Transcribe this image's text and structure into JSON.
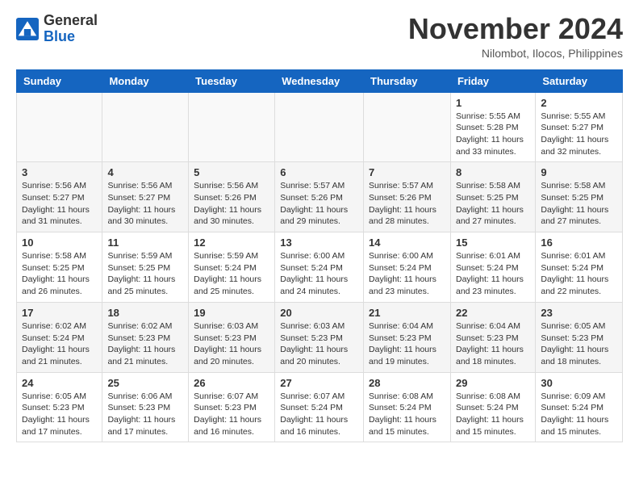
{
  "header": {
    "logo_general": "General",
    "logo_blue": "Blue",
    "month_title": "November 2024",
    "location": "Nilombot, Ilocos, Philippines"
  },
  "weekdays": [
    "Sunday",
    "Monday",
    "Tuesday",
    "Wednesday",
    "Thursday",
    "Friday",
    "Saturday"
  ],
  "weeks": [
    [
      {
        "day": "",
        "detail": ""
      },
      {
        "day": "",
        "detail": ""
      },
      {
        "day": "",
        "detail": ""
      },
      {
        "day": "",
        "detail": ""
      },
      {
        "day": "",
        "detail": ""
      },
      {
        "day": "1",
        "detail": "Sunrise: 5:55 AM\nSunset: 5:28 PM\nDaylight: 11 hours\nand 33 minutes."
      },
      {
        "day": "2",
        "detail": "Sunrise: 5:55 AM\nSunset: 5:27 PM\nDaylight: 11 hours\nand 32 minutes."
      }
    ],
    [
      {
        "day": "3",
        "detail": "Sunrise: 5:56 AM\nSunset: 5:27 PM\nDaylight: 11 hours\nand 31 minutes."
      },
      {
        "day": "4",
        "detail": "Sunrise: 5:56 AM\nSunset: 5:27 PM\nDaylight: 11 hours\nand 30 minutes."
      },
      {
        "day": "5",
        "detail": "Sunrise: 5:56 AM\nSunset: 5:26 PM\nDaylight: 11 hours\nand 30 minutes."
      },
      {
        "day": "6",
        "detail": "Sunrise: 5:57 AM\nSunset: 5:26 PM\nDaylight: 11 hours\nand 29 minutes."
      },
      {
        "day": "7",
        "detail": "Sunrise: 5:57 AM\nSunset: 5:26 PM\nDaylight: 11 hours\nand 28 minutes."
      },
      {
        "day": "8",
        "detail": "Sunrise: 5:58 AM\nSunset: 5:25 PM\nDaylight: 11 hours\nand 27 minutes."
      },
      {
        "day": "9",
        "detail": "Sunrise: 5:58 AM\nSunset: 5:25 PM\nDaylight: 11 hours\nand 27 minutes."
      }
    ],
    [
      {
        "day": "10",
        "detail": "Sunrise: 5:58 AM\nSunset: 5:25 PM\nDaylight: 11 hours\nand 26 minutes."
      },
      {
        "day": "11",
        "detail": "Sunrise: 5:59 AM\nSunset: 5:25 PM\nDaylight: 11 hours\nand 25 minutes."
      },
      {
        "day": "12",
        "detail": "Sunrise: 5:59 AM\nSunset: 5:24 PM\nDaylight: 11 hours\nand 25 minutes."
      },
      {
        "day": "13",
        "detail": "Sunrise: 6:00 AM\nSunset: 5:24 PM\nDaylight: 11 hours\nand 24 minutes."
      },
      {
        "day": "14",
        "detail": "Sunrise: 6:00 AM\nSunset: 5:24 PM\nDaylight: 11 hours\nand 23 minutes."
      },
      {
        "day": "15",
        "detail": "Sunrise: 6:01 AM\nSunset: 5:24 PM\nDaylight: 11 hours\nand 23 minutes."
      },
      {
        "day": "16",
        "detail": "Sunrise: 6:01 AM\nSunset: 5:24 PM\nDaylight: 11 hours\nand 22 minutes."
      }
    ],
    [
      {
        "day": "17",
        "detail": "Sunrise: 6:02 AM\nSunset: 5:24 PM\nDaylight: 11 hours\nand 21 minutes."
      },
      {
        "day": "18",
        "detail": "Sunrise: 6:02 AM\nSunset: 5:23 PM\nDaylight: 11 hours\nand 21 minutes."
      },
      {
        "day": "19",
        "detail": "Sunrise: 6:03 AM\nSunset: 5:23 PM\nDaylight: 11 hours\nand 20 minutes."
      },
      {
        "day": "20",
        "detail": "Sunrise: 6:03 AM\nSunset: 5:23 PM\nDaylight: 11 hours\nand 20 minutes."
      },
      {
        "day": "21",
        "detail": "Sunrise: 6:04 AM\nSunset: 5:23 PM\nDaylight: 11 hours\nand 19 minutes."
      },
      {
        "day": "22",
        "detail": "Sunrise: 6:04 AM\nSunset: 5:23 PM\nDaylight: 11 hours\nand 18 minutes."
      },
      {
        "day": "23",
        "detail": "Sunrise: 6:05 AM\nSunset: 5:23 PM\nDaylight: 11 hours\nand 18 minutes."
      }
    ],
    [
      {
        "day": "24",
        "detail": "Sunrise: 6:05 AM\nSunset: 5:23 PM\nDaylight: 11 hours\nand 17 minutes."
      },
      {
        "day": "25",
        "detail": "Sunrise: 6:06 AM\nSunset: 5:23 PM\nDaylight: 11 hours\nand 17 minutes."
      },
      {
        "day": "26",
        "detail": "Sunrise: 6:07 AM\nSunset: 5:23 PM\nDaylight: 11 hours\nand 16 minutes."
      },
      {
        "day": "27",
        "detail": "Sunrise: 6:07 AM\nSunset: 5:24 PM\nDaylight: 11 hours\nand 16 minutes."
      },
      {
        "day": "28",
        "detail": "Sunrise: 6:08 AM\nSunset: 5:24 PM\nDaylight: 11 hours\nand 15 minutes."
      },
      {
        "day": "29",
        "detail": "Sunrise: 6:08 AM\nSunset: 5:24 PM\nDaylight: 11 hours\nand 15 minutes."
      },
      {
        "day": "30",
        "detail": "Sunrise: 6:09 AM\nSunset: 5:24 PM\nDaylight: 11 hours\nand 15 minutes."
      }
    ]
  ]
}
